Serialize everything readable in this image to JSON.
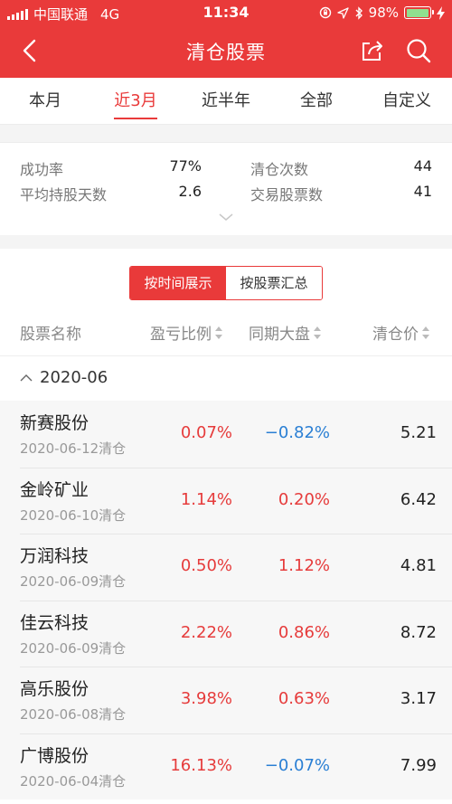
{
  "status": {
    "carrier": "中国联通",
    "network": "4G",
    "time": "11:34",
    "battery": "98%",
    "battery_level": 0.98
  },
  "header": {
    "title": "清仓股票",
    "icons": [
      "back-arrow-icon",
      "share-icon",
      "search-icon"
    ]
  },
  "tabs": [
    {
      "label": "本月",
      "active": false
    },
    {
      "label": "近3月",
      "active": true
    },
    {
      "label": "近半年",
      "active": false
    },
    {
      "label": "全部",
      "active": false
    },
    {
      "label": "自定义",
      "active": false
    }
  ],
  "stats": {
    "success_rate_label": "成功率",
    "success_rate": "77%",
    "clear_count_label": "清仓次数",
    "clear_count": "44",
    "avg_hold_label": "平均持股天数",
    "avg_hold": "2.6",
    "traded_stocks_label": "交易股票数",
    "traded_stocks": "41"
  },
  "view_toggle": {
    "by_time": "按时间展示",
    "by_stock": "按股票汇总"
  },
  "columns": {
    "name": "股票名称",
    "pnl": "盈亏比例",
    "market": "同期大盘",
    "price": "清仓价"
  },
  "group": {
    "label": "2020-06",
    "expanded": true
  },
  "rows": [
    {
      "name": "新赛股份",
      "sub": "2020-06-12清仓",
      "pnl": "0.07%",
      "market": "−0.82%",
      "price": "5.21"
    },
    {
      "name": "金岭矿业",
      "sub": "2020-06-10清仓",
      "pnl": "1.14%",
      "market": "0.20%",
      "price": "6.42"
    },
    {
      "name": "万润科技",
      "sub": "2020-06-09清仓",
      "pnl": "0.50%",
      "market": "1.12%",
      "price": "4.81"
    },
    {
      "name": "佳云科技",
      "sub": "2020-06-09清仓",
      "pnl": "2.22%",
      "market": "0.86%",
      "price": "8.72"
    },
    {
      "name": "高乐股份",
      "sub": "2020-06-08清仓",
      "pnl": "3.98%",
      "market": "0.63%",
      "price": "3.17"
    },
    {
      "name": "广博股份",
      "sub": "2020-06-04清仓",
      "pnl": "16.13%",
      "market": "−0.07%",
      "price": "7.99"
    }
  ],
  "colors": {
    "brand_red": "#e93a3a",
    "gain": "#e63b3b",
    "loss": "#2a7fd4"
  }
}
